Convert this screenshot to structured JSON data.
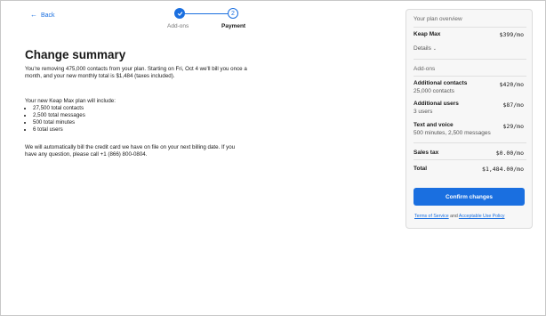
{
  "nav": {
    "back_label": "Back"
  },
  "stepper": {
    "step2_number": "2",
    "step1_label": "Add-ons",
    "step2_label": "Payment"
  },
  "main": {
    "title": "Change summary",
    "para1": "You're removing 475,000 contacts from your plan. Starting on Fri, Oct 4 we'll bill you once a month, and your new monthly total is $1,484 (taxes included).",
    "para2_intro": "Your new Keap Max plan will include:",
    "plan_items": [
      "27,500 total contacts",
      "2,500 total messages",
      "500 total minutes",
      "6 total users"
    ],
    "para3": "We will automatically bill the credit card we have on file on your next billing date. If you have any question, please call +1 (866) 800-0804."
  },
  "summary": {
    "header": "Your plan overview",
    "plan_name": "Keap Max",
    "plan_price": "$399/mo",
    "details_label": "Details",
    "addons_header": "Add-ons",
    "addons": [
      {
        "name": "Additional contacts",
        "sub": "25,000 contacts",
        "price": "$420/mo"
      },
      {
        "name": "Additional users",
        "sub": "3 users",
        "price": "$87/mo"
      },
      {
        "name": "Text and voice",
        "sub": "500 minutes, 2,500 messages",
        "price": "$29/mo"
      }
    ],
    "sales_tax_label": "Sales tax",
    "sales_tax_value": "$0.00/mo",
    "total_label": "Total",
    "total_value": "$1,484.00/mo",
    "confirm_label": "Confirm changes",
    "terms_label": "Terms of Service",
    "and_label": "and",
    "aup_label": "Acceptable Use Policy"
  }
}
